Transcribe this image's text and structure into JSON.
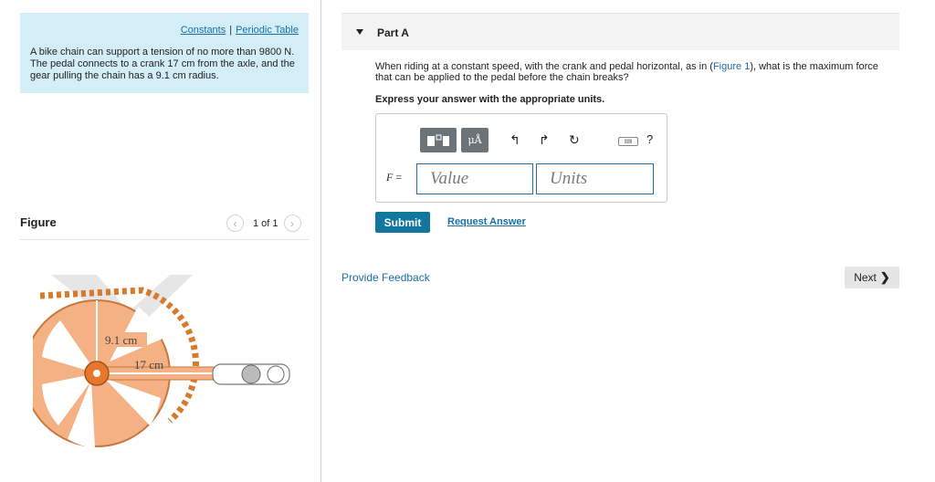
{
  "problem": {
    "links": [
      "Constants",
      "Periodic Table"
    ],
    "text": "A bike chain can support a tension of no more than 9800 N. The pedal connects to a crank 17 cm from the axle, and the gear pulling the chain has a 9.1 cm radius."
  },
  "figure": {
    "title": "Figure",
    "pager": "1 of 1",
    "labels": {
      "gear_radius": "9.1 cm",
      "crank_length": "17 cm"
    }
  },
  "part": {
    "label": "Part A",
    "question_pre": "When riding at a constant speed, with the crank and pedal horizontal, as in (",
    "question_link": "Figure 1",
    "question_post": "), what is the maximum force that can be applied to the pedal before the chain breaks?",
    "express": "Express your answer with the appropriate units.",
    "toolbar": {
      "units_button": "μÅ",
      "help": "?",
      "keyboard": "kbd"
    },
    "variable": "F",
    "equals": " =",
    "value_placeholder": "Value",
    "units_placeholder": "Units",
    "submit": "Submit",
    "request_answer": "Request Answer"
  },
  "footer": {
    "feedback": "Provide Feedback",
    "next": "Next"
  },
  "colors": {
    "accent": "#1a6fa3",
    "problem_bg": "#d4eef7",
    "submit_bg": "#12779e",
    "gear": "#f4b183"
  }
}
